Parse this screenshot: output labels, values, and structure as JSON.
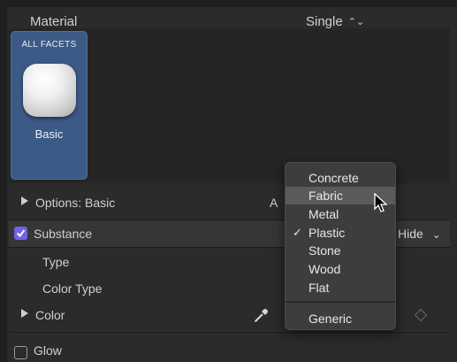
{
  "header": {
    "label": "Material",
    "mode": "Single",
    "mode_icon": "up-down-chevrons-icon"
  },
  "facet": {
    "title": "ALL FACETS",
    "name": "Basic"
  },
  "options": {
    "label": "Options: Basic",
    "obscured_text": "A"
  },
  "substance": {
    "label": "Substance",
    "checked": true,
    "hide_label": "Hide",
    "hide_icon": "chevron-down-icon"
  },
  "type_row": {
    "label": "Type"
  },
  "colortype_row": {
    "label": "Color Type"
  },
  "color_row": {
    "label": "Color"
  },
  "glow": {
    "label": "Glow",
    "checked": false
  },
  "menu": {
    "items": [
      {
        "label": "Concrete",
        "checked": false,
        "highlighted": false
      },
      {
        "label": "Fabric",
        "checked": false,
        "highlighted": true
      },
      {
        "label": "Metal",
        "checked": false,
        "highlighted": false
      },
      {
        "label": "Plastic",
        "checked": true,
        "highlighted": false
      },
      {
        "label": "Stone",
        "checked": false,
        "highlighted": false
      },
      {
        "label": "Wood",
        "checked": false,
        "highlighted": false
      },
      {
        "label": "Flat",
        "checked": false,
        "highlighted": false
      }
    ],
    "check_glyph": "✓",
    "footer_item": "Generic"
  },
  "colors": {
    "accent": "#6f63e6",
    "facet_selected": "#3c5a86",
    "menu_highlight": "#5a5a5a"
  }
}
